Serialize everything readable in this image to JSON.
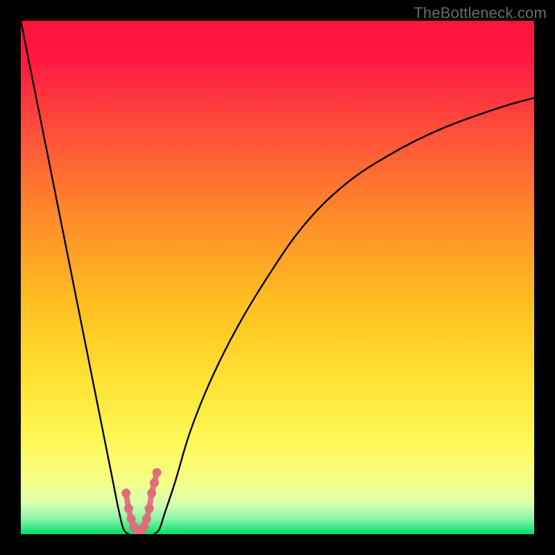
{
  "watermark": "TheBottleneck.com",
  "chart_data": {
    "type": "line",
    "title": "",
    "xlabel": "",
    "ylabel": "",
    "xlim": [
      0,
      100
    ],
    "ylim": [
      0,
      100
    ],
    "legend": null,
    "background_gradient": {
      "top": "#ff1a42",
      "upper_mid": "#ff8a2a",
      "mid": "#ffd321",
      "lower_mid": "#fff858",
      "near_bottom": "#d9ffb0",
      "bottom": "#00e06a"
    },
    "series": [
      {
        "name": "left-descending-curve",
        "x": [
          0,
          2,
          4,
          6,
          8,
          10,
          12,
          14,
          16,
          18,
          19,
          20,
          21
        ],
        "y": [
          100,
          90,
          80,
          70,
          60,
          50,
          40,
          30,
          20,
          10,
          5,
          1,
          0
        ]
      },
      {
        "name": "right-ascending-curve",
        "x": [
          26,
          27,
          28,
          30,
          33,
          37,
          42,
          48,
          55,
          63,
          72,
          82,
          93,
          100
        ],
        "y": [
          0,
          1,
          4,
          10,
          20,
          30,
          40,
          50,
          60,
          68,
          74,
          79,
          83,
          85
        ]
      },
      {
        "name": "trough-marker",
        "style": "dotted-pink-u",
        "x": [
          20.5,
          21,
          21.5,
          22,
          22.5,
          23,
          23.5,
          24,
          24.5,
          25,
          25.5,
          26,
          26.5
        ],
        "y": [
          8,
          5,
          3,
          1.5,
          0.8,
          0.5,
          0.8,
          1.5,
          3,
          5,
          8,
          10,
          12
        ]
      }
    ]
  }
}
